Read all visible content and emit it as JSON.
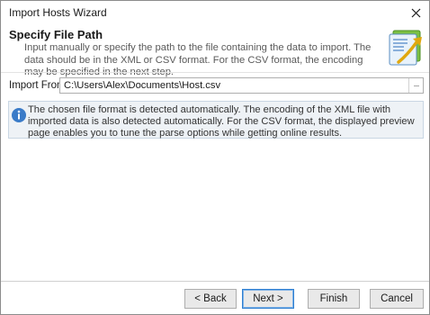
{
  "window": {
    "title": "Import Hosts Wizard",
    "close_glyph": "✕"
  },
  "header": {
    "title": "Specify File Path",
    "description": "Input manually or specify the path to the file containing the data to import. The data should be in the XML or CSV format. For the CSV format, the encoding may be specified in the next step.",
    "icon": "import-file-icon"
  },
  "import": {
    "label": "Import From:",
    "value": "C:\\Users\\Alex\\Documents\\Host.csv",
    "browse_label": "···"
  },
  "info": {
    "icon": "info-icon",
    "text": "The chosen file format is detected automatically. The encoding of the XML file with imported data is also detected automatically. For the CSV format, the displayed preview page enables you to tune the parse options while getting online results."
  },
  "buttons": {
    "back": "< Back",
    "next": "Next >",
    "finish": "Finish",
    "cancel": "Cancel"
  },
  "colors": {
    "accent": "#2f7fd1",
    "info_bg": "#eef2f6",
    "info_icon": "#3a7bc8"
  }
}
